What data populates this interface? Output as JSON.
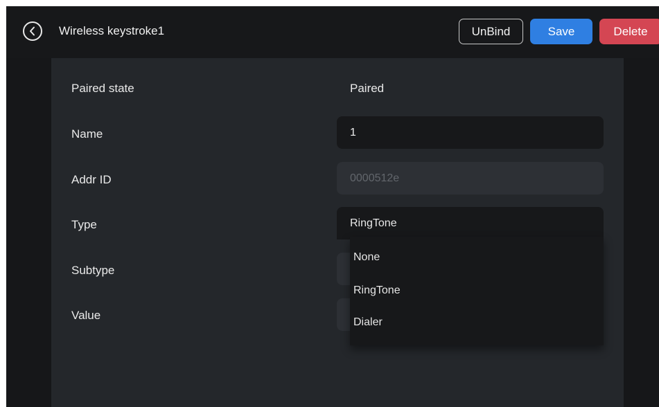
{
  "header": {
    "title": "Wireless keystroke1",
    "back_icon": "chevron-left-icon",
    "unbind_label": "UnBind",
    "save_label": "Save",
    "delete_label": "Delete"
  },
  "colors": {
    "save": "#2f7fe2",
    "delete": "#d44653",
    "background": "#161719",
    "panel": "#24272b"
  },
  "form": {
    "paired_state": {
      "label": "Paired state",
      "value": "Paired"
    },
    "name": {
      "label": "Name",
      "value": "1"
    },
    "addr_id": {
      "label": "Addr ID",
      "value": "0000512e"
    },
    "type": {
      "label": "Type",
      "value": "RingTone",
      "options": [
        "None",
        "RingTone",
        "Dialer"
      ]
    },
    "subtype": {
      "label": "Subtype"
    },
    "value": {
      "label": "Value"
    }
  }
}
